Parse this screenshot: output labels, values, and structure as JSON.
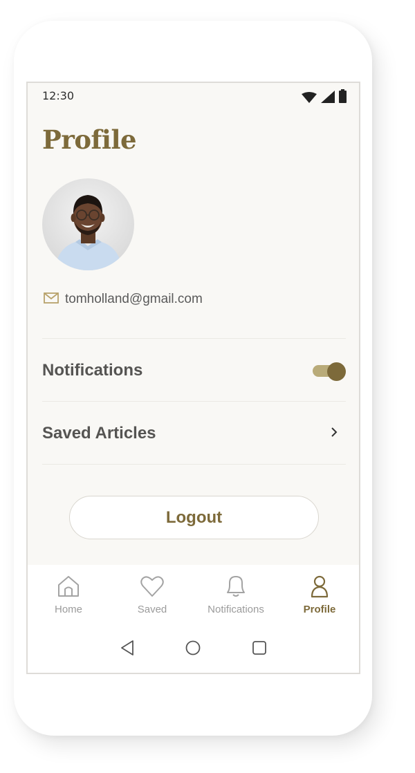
{
  "status_bar": {
    "time": "12:30",
    "icons": [
      "wifi-icon",
      "cellular-icon",
      "battery-icon"
    ]
  },
  "page": {
    "title": "Profile"
  },
  "profile": {
    "email": "tomholland@gmail.com"
  },
  "settings": {
    "notifications_label": "Notifications",
    "notifications_enabled": true,
    "saved_articles_label": "Saved Articles"
  },
  "actions": {
    "logout_label": "Logout"
  },
  "tabbar": {
    "items": [
      {
        "label": "Home",
        "icon": "home-icon",
        "active": false
      },
      {
        "label": "Saved",
        "icon": "heart-icon",
        "active": false
      },
      {
        "label": "Notifications",
        "icon": "bell-icon",
        "active": false
      },
      {
        "label": "Profile",
        "icon": "user-icon",
        "active": true
      }
    ]
  },
  "system_nav": [
    "back-icon",
    "home-circle-icon",
    "recents-icon"
  ],
  "colors": {
    "accent": "#7d6a3a",
    "accent_light": "#b9ab79",
    "background": "#f9f8f5",
    "text": "#555452",
    "muted": "#9b9b9b"
  }
}
